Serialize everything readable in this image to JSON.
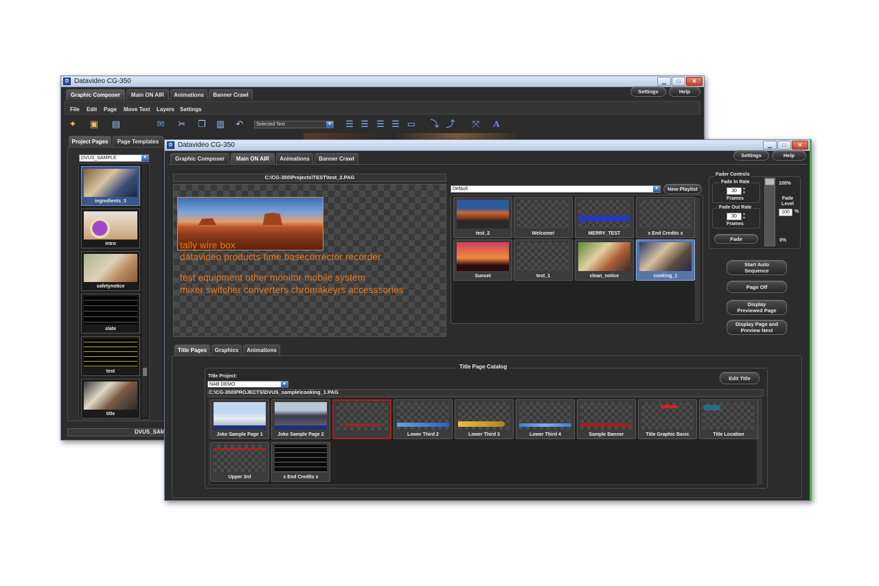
{
  "back_window": {
    "title": "Datavideo CG-350",
    "tabs": [
      "Graphic Composer",
      "Main ON AIR",
      "Animations",
      "Banner Crawl"
    ],
    "settings_label": "Settings",
    "help_label": "Help",
    "menu": [
      "File",
      "Edit",
      "Page",
      "Move Text",
      "Layers",
      "Settings"
    ],
    "selected_text_dropdown": "Selected Text",
    "side_tabs": [
      "Project Pages",
      "Page Templates"
    ],
    "project_dropdown": "DVUS_SAMPLE",
    "project_pages": [
      "ingredients_3",
      "intro",
      "safetynotice",
      "slate",
      "test",
      "title"
    ],
    "footer_text": "DVUS_SAM"
  },
  "front_window": {
    "title": "Datavideo CG-350",
    "tabs": [
      "Graphic Composer",
      "Main ON AIR",
      "Animations",
      "Banner Crawl"
    ],
    "settings_label": "Settings",
    "help_label": "Help",
    "preview_path": "C:\\CG-350\\Projects\\TEST\\test_2.PAG",
    "preview_lines": [
      "tally wire box",
      "datavideo products time basecorrector recorder",
      "test equipment other monitor mobile system",
      "mixer switcher converters chromakeyrs accesssories"
    ],
    "playlist_dropdown": "Default",
    "new_playlist_label": "New Playlist",
    "playlist_items": [
      "test_2",
      "Welcome!",
      "MERRY_TEST",
      "x End Credits x",
      "Sunset",
      "test_1",
      "clean_notice",
      "cooking_1"
    ],
    "fader": {
      "title": "Fader Controls",
      "fade_in_label": "Fade In Rate",
      "fade_in_value": "30",
      "fade_out_label": "Fade Out Rate",
      "fade_out_value": "30",
      "frames_label": "Frames",
      "fade_button": "Fade",
      "top_pct": "100%",
      "fade_level_label": "Fade Level",
      "level_value": "100",
      "pct_sign": "%",
      "bottom_pct": "0%"
    },
    "action_buttons": [
      "Start Auto Sequence",
      "Page Off",
      "Display Previewed Page",
      "Display Page and Preview Next"
    ],
    "bottom_tabs": [
      "Title Pages",
      "Graphics",
      "Animations"
    ],
    "catalog": {
      "title": "Title Page Catalog",
      "project_label": "Title Project:",
      "project_value": "NAB DEMO",
      "edit_title_label": "Edit Title",
      "path": "C:\\CG-350\\PROJECTS\\DVUS_sample\\cooking_1.PAG",
      "items": [
        "Joke Sample Page 1",
        "Joke Sample Page 2",
        "",
        "Lower Third 2",
        "Lower Third 3",
        "Lower Third 4",
        "Sample Banner",
        "Title Graphic Basic",
        "Title Location",
        "Upper 3rd",
        "x End Credits x"
      ]
    }
  }
}
